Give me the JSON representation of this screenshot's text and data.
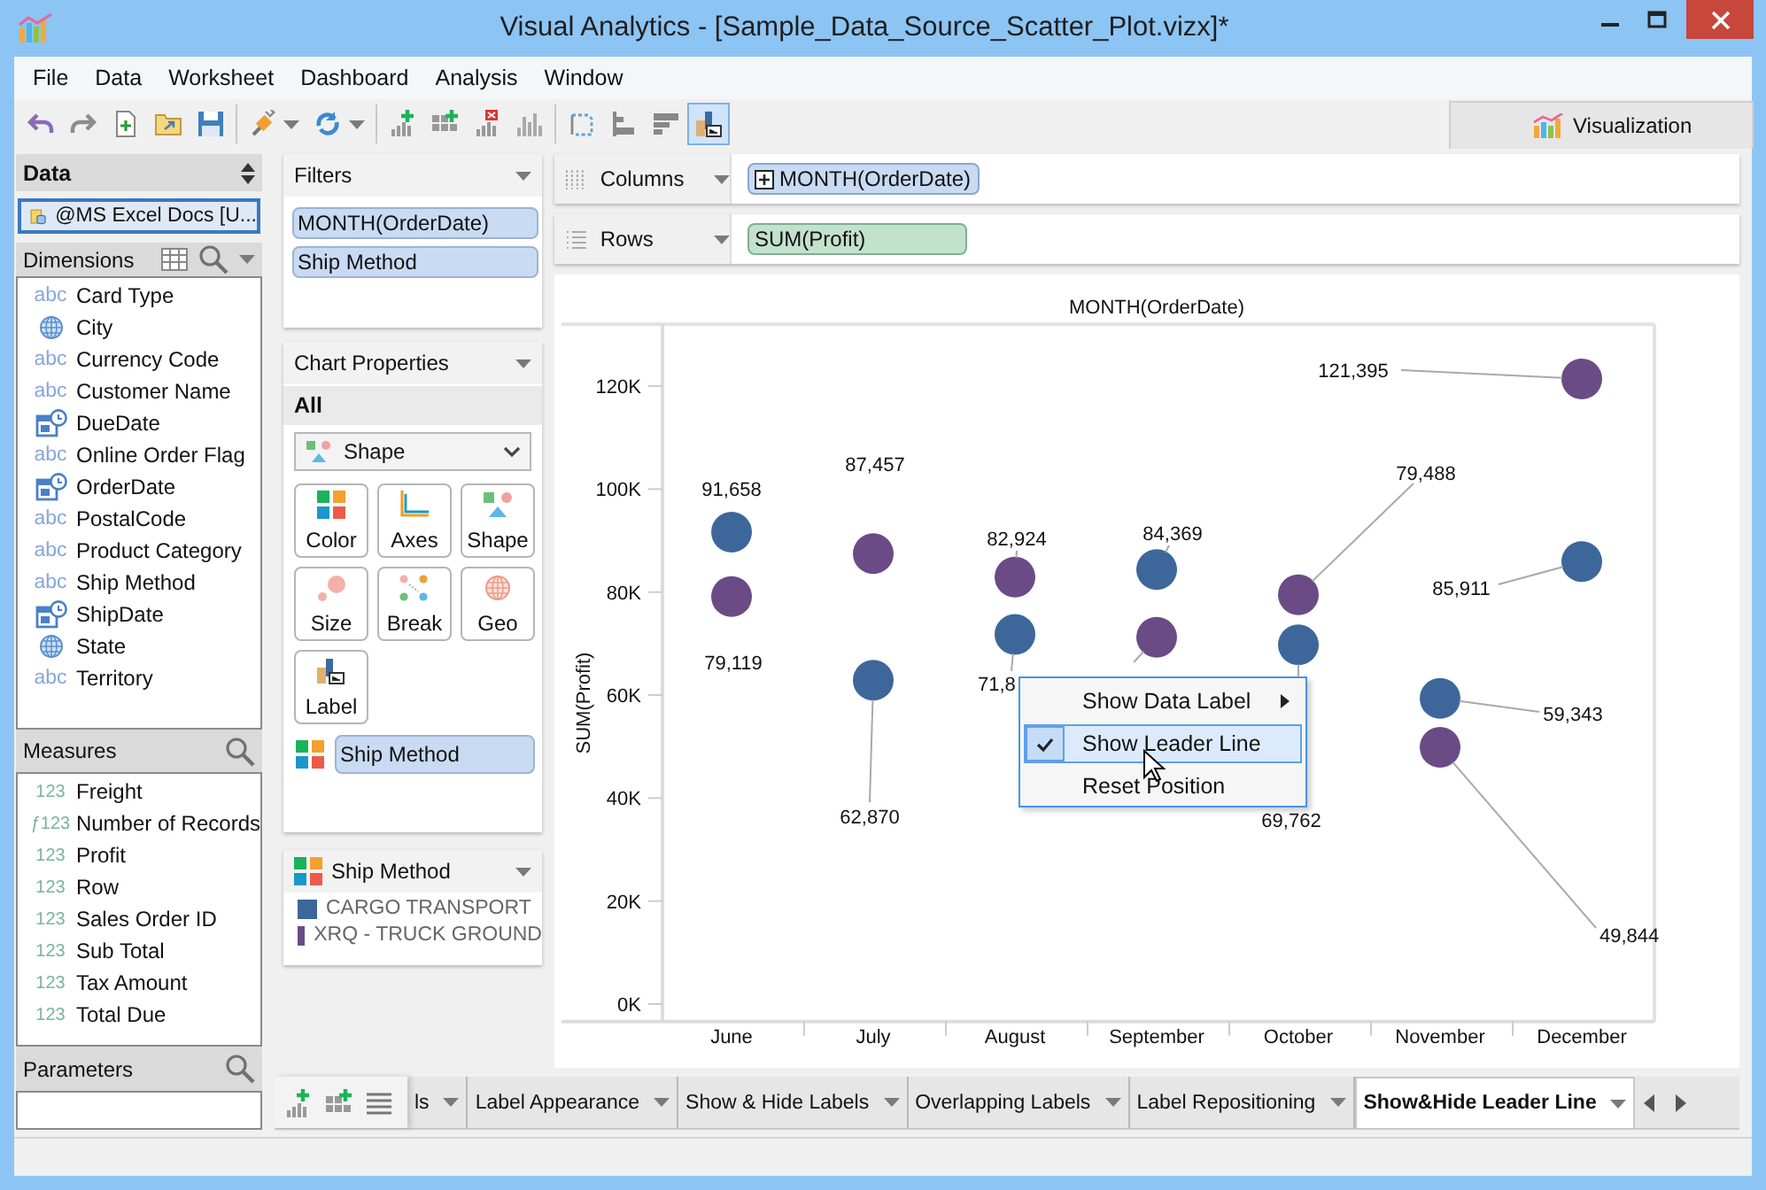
{
  "window": {
    "title": "Visual Analytics - [Sample_Data_Source_Scatter_Plot.vizx]*"
  },
  "menu": [
    "File",
    "Data",
    "Worksheet",
    "Dashboard",
    "Analysis",
    "Window"
  ],
  "toolbar": {
    "buttons": [
      {
        "selected": false
      },
      {
        "selected": false
      },
      {
        "selected": false
      },
      {
        "selected": false
      },
      {
        "selected": false
      },
      {
        "selected": false
      },
      {
        "selected": false
      },
      {
        "selected": false
      },
      {
        "selected": false
      },
      {
        "selected": false
      },
      {
        "selected": false
      },
      {
        "selected": false
      },
      {
        "selected": false
      },
      {
        "selected": false
      },
      {
        "selected": true
      }
    ]
  },
  "view_tab": {
    "label": "Visualization",
    "selected": true
  },
  "data_panel": {
    "title": "Data",
    "source": {
      "label": "@MS Excel Docs [U...",
      "selected": true
    },
    "dimensions": {
      "title": "Dimensions",
      "items": [
        {
          "name": "Card Type",
          "kind": "text",
          "badge": "abc"
        },
        {
          "name": "City",
          "kind": "geo"
        },
        {
          "name": "Currency Code",
          "kind": "text",
          "badge": "abc"
        },
        {
          "name": "Customer Name",
          "kind": "text",
          "badge": "abc"
        },
        {
          "name": "DueDate",
          "kind": "date"
        },
        {
          "name": "Online Order Flag",
          "kind": "text",
          "badge": "abc"
        },
        {
          "name": "OrderDate",
          "kind": "date"
        },
        {
          "name": "PostalCode",
          "kind": "text",
          "badge": "abc"
        },
        {
          "name": "Product Category",
          "kind": "text",
          "badge": "abc"
        },
        {
          "name": "Ship Method",
          "kind": "text",
          "badge": "abc"
        },
        {
          "name": "ShipDate",
          "kind": "date"
        },
        {
          "name": "State",
          "kind": "geo"
        },
        {
          "name": "Territory",
          "kind": "text",
          "badge": "abc"
        }
      ]
    },
    "measures": {
      "title": "Measures",
      "items": [
        {
          "name": "Freight",
          "badge": "123"
        },
        {
          "name": "Number of Records",
          "badge": "ƒ123"
        },
        {
          "name": "Profit",
          "badge": "123"
        },
        {
          "name": "Row",
          "badge": "123"
        },
        {
          "name": "Sales Order ID",
          "badge": "123"
        },
        {
          "name": "Sub Total",
          "badge": "123"
        },
        {
          "name": "Tax Amount",
          "badge": "123"
        },
        {
          "name": "Total Due",
          "badge": "123"
        }
      ]
    },
    "parameters": {
      "title": "Parameters"
    }
  },
  "filters": {
    "title": "Filters",
    "pills": [
      "MONTH(OrderDate)",
      "Ship Method"
    ]
  },
  "chart_properties": {
    "title": "Chart Properties",
    "scope": "All",
    "mark_type": "Shape",
    "buttons": [
      "Color",
      "Axes",
      "Shape",
      "Size",
      "Break",
      "Geo",
      "Label"
    ],
    "color_field": "Ship Method"
  },
  "legend": {
    "title": "Ship Method"
  },
  "shelves": [
    {
      "label": "Columns",
      "kind": "dimension",
      "pill": "MONTH(OrderDate)"
    },
    {
      "label": "Rows",
      "kind": "measure",
      "pill": "SUM(Profit)"
    }
  ],
  "chart": {
    "chart_data": {
      "type": "scatter",
      "title": "MONTH(OrderDate)",
      "ylabel": "SUM(Profit)",
      "categories": [
        "June",
        "July",
        "August",
        "September",
        "October",
        "November",
        "December"
      ],
      "ylim": [
        -3400,
        132000
      ],
      "yticks": [
        {
          "value": 0,
          "label": "0K"
        },
        {
          "value": 20000,
          "label": "20K"
        },
        {
          "value": 40000,
          "label": "40K"
        },
        {
          "value": 60000,
          "label": "60K"
        },
        {
          "value": 80000,
          "label": "80K"
        },
        {
          "value": 100000,
          "label": "100K"
        },
        {
          "value": 120000,
          "label": "120K"
        }
      ],
      "series": [
        {
          "name": "CARGO TRANSPORT",
          "color": "#3d679b",
          "values": [
            91658,
            62870,
            71800,
            84369,
            69762,
            59343,
            85911
          ]
        },
        {
          "name": "XRQ - TRUCK GROUND",
          "color": "#6a4b86",
          "values": [
            79119,
            87457,
            82924,
            71230,
            79488,
            49844,
            121395
          ]
        }
      ]
    },
    "point_labels": [
      [
        {
          "kind": "label",
          "text": "91,658"
        },
        {
          "kind": "label",
          "text": "62,870"
        },
        {
          "kind": "label",
          "text": "71,8"
        },
        {
          "kind": "label",
          "text": "84,369"
        },
        {
          "kind": "label",
          "text": "69,762"
        },
        {
          "kind": "label",
          "text": "59,343"
        },
        {
          "kind": "label",
          "text": "85,911"
        }
      ],
      [
        {
          "kind": "label",
          "text": "79,119"
        },
        {
          "kind": "label",
          "text": "87,457"
        },
        {
          "kind": "label",
          "text": "82,924"
        },
        {
          "kind": "line"
        },
        {
          "kind": "label",
          "text": "79,488"
        },
        {
          "kind": "label",
          "text": "49,844"
        },
        {
          "kind": "label",
          "text": "121,395"
        }
      ]
    ]
  },
  "context_menu": {
    "items": [
      {
        "label": "Show Data Label",
        "submenu": true,
        "checked": false,
        "selected": false
      },
      {
        "label": "Show Leader Line",
        "submenu": false,
        "checked": true,
        "selected": true
      },
      {
        "label": "Reset Position",
        "submenu": false,
        "checked": false,
        "selected": false
      }
    ]
  },
  "sheet_tabs": [
    {
      "label": "ls",
      "selected": false
    },
    {
      "label": "Label Appearance",
      "selected": false
    },
    {
      "label": "Show & Hide Labels",
      "selected": false
    },
    {
      "label": "Overlapping Labels",
      "selected": false
    },
    {
      "label": "Label Repositioning",
      "selected": false
    },
    {
      "label": "Show&Hide Leader Line",
      "selected": true
    }
  ]
}
